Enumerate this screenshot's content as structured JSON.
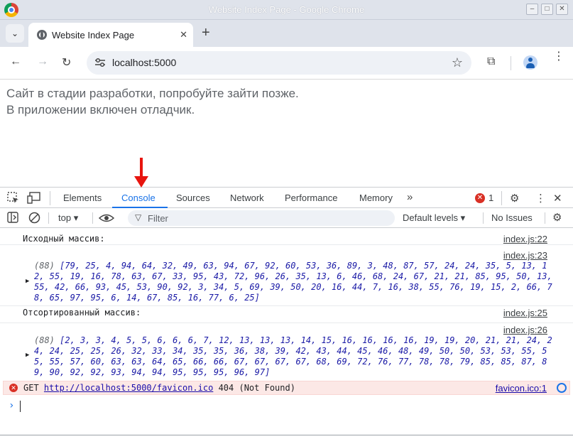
{
  "window": {
    "title": "Website Index Page - Google Chrome"
  },
  "tab": {
    "title": "Website Index Page"
  },
  "address": {
    "url": "localhost:5000"
  },
  "page": {
    "line1": "Сайт в стадии разработки, попробуйте зайти позже.",
    "line2": "В приложении включен отладчик."
  },
  "devtools": {
    "tabs": [
      "Elements",
      "Console",
      "Sources",
      "Network",
      "Performance",
      "Memory"
    ],
    "active_tab": "Console",
    "error_count": "1",
    "context": "top",
    "filter_placeholder": "Filter",
    "levels": "Default levels",
    "issues": "No Issues"
  },
  "console": {
    "msg1_text": "Исходный массив:",
    "msg1_src": "index.js:22",
    "msg2_src": "index.js:23",
    "msg2_count": "(88)",
    "msg2_array": "[79, 25, 4, 94, 64, 32, 49, 63, 94, 67, 92, 60, 53, 36, 89, 3, 48, 87, 57, 24, 24, 35, 5, 13, 12, 55, 19, 16, 78, 63, 67, 33, 95, 43, 72, 96, 26, 35, 13, 6, 46, 68, 24, 67, 21, 21, 85, 95, 50, 13, 55, 42, 66, 93, 45, 53, 90, 92, 3, 34, 5, 69, 39, 50, 20, 16, 44, 7, 16, 38, 55, 76, 19, 15, 2, 66, 78, 65, 97, 95, 6, 14, 67, 85, 16, 77, 6, 25]",
    "msg3_text": "Отсортированный массив:",
    "msg3_src": "index.js:25",
    "msg4_src": "index.js:26",
    "msg4_count": "(88)",
    "msg4_array": "[2, 3, 3, 4, 5, 5, 6, 6, 6, 7, 12, 13, 13, 13, 14, 15, 16, 16, 16, 16, 19, 19, 20, 21, 21, 24, 24, 24, 25, 25, 26, 32, 33, 34, 35, 35, 36, 38, 39, 42, 43, 44, 45, 46, 48, 49, 50, 50, 53, 53, 55, 55, 55, 57, 60, 63, 63, 64, 65, 66, 66, 67, 67, 67, 67, 68, 69, 72, 76, 77, 78, 78, 79, 85, 85, 87, 89, 90, 92, 92, 93, 94, 94, 95, 95, 95, 96, 97]",
    "error_method": "GET",
    "error_url": "http://localhost:5000/favicon.ico",
    "error_status": "404 (Not Found)",
    "error_src": "favicon.ico:1"
  }
}
